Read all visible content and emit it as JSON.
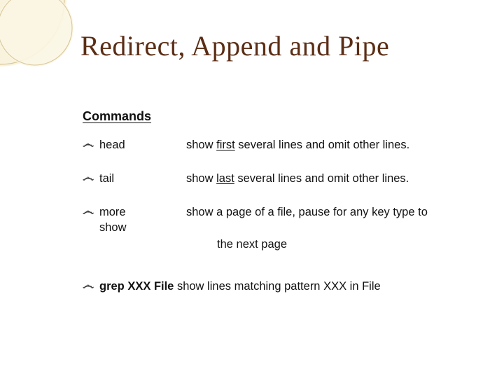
{
  "title": "Redirect, Append and Pipe",
  "section_heading": "Commands",
  "bullet_glyph": "෴",
  "items": [
    {
      "cmd": "head",
      "desc_pre": "show ",
      "desc_u": "first",
      "desc_post": " several lines and omit other lines."
    },
    {
      "cmd": "tail",
      "desc_pre": "show ",
      "desc_u": "last",
      "desc_post": " several lines and omit other lines."
    },
    {
      "cmd": "more",
      "cmd_line2": "show",
      "desc_pre": "show a page of a file, pause for any key type to",
      "desc_u": "",
      "desc_post": ""
    }
  ],
  "continuation": "the next page",
  "last_item": {
    "cmd_bold": "grep XXX File",
    "desc": " show lines matching pattern XXX in File"
  },
  "colors": {
    "title": "#5b2d15",
    "deco_light": "#f4eccf",
    "deco_line": "#d8c79a"
  }
}
